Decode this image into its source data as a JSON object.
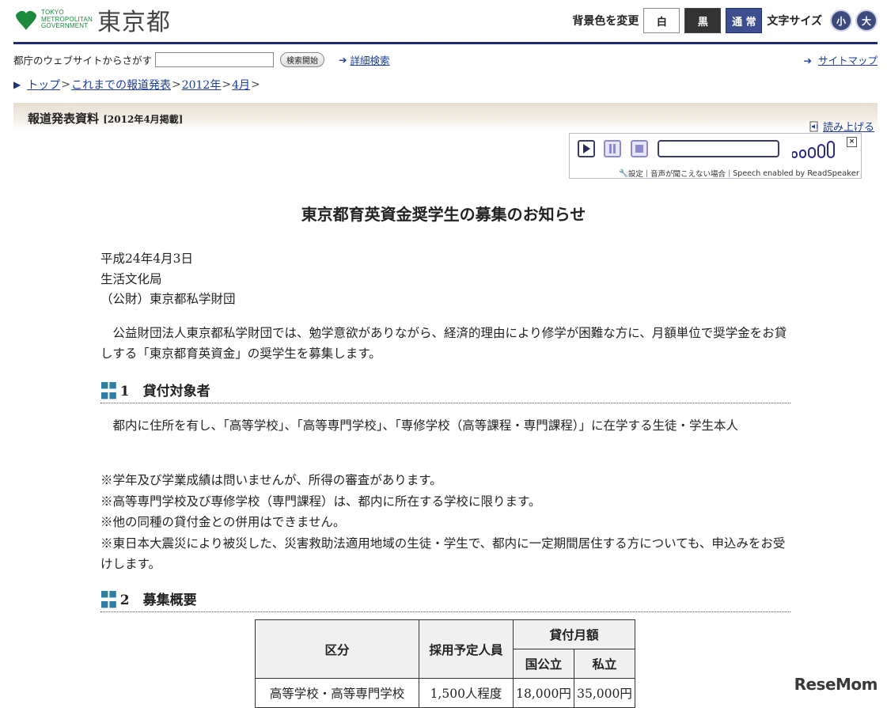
{
  "header": {
    "logo_small": [
      "TOKYO",
      "METROPOLITAN",
      "GOVERNMENT"
    ],
    "logo_big": "東京都",
    "bg_change_label": "背景色を変更",
    "bg_white": "白",
    "bg_black": "黒",
    "bg_normal": "通 常",
    "font_size_label": "文字サイズ",
    "font_small": "小",
    "font_large": "大"
  },
  "search": {
    "label": "都庁のウェブサイトからさがす",
    "value": "",
    "button": "検索開始",
    "advanced_link": "詳細検索",
    "sitemap_link": "サイトマップ"
  },
  "breadcrumb": {
    "items": [
      "トップ",
      "これまでの報道発表",
      "2012年",
      "4月"
    ],
    "separator": ">"
  },
  "banner": {
    "title": "報道発表資料",
    "date": "[2012年4月掲載]",
    "read_aloud": "読み上げる"
  },
  "speaker": {
    "settings": "設定",
    "help": "音声が聞こえない場合",
    "powered": "Speech enabled by",
    "brand": "ReadSpeaker"
  },
  "article": {
    "title": "東京都育英資金奨学生の募集のお知らせ",
    "date": "平成24年4月3日",
    "dept1": "生活文化局",
    "dept2": "（公財）東京都私学財団",
    "intro": "公益財団法人東京都私学財団では、勉学意欲がありながら、経済的理由により修学が困難な方に、月額単位で奨学金をお貸しする「東京都育英資金」の奨学生を募集します。",
    "section1_title": "1　貸付対象者",
    "section1_body": "都内に住所を有し、「高等学校」、「高等専門学校」、「専修学校（高等課程・専門課程）」に在学する生徒・学生本人",
    "notes": [
      "※学年及び学業成績は問いませんが、所得の審査があります。",
      "※高等専門学校及び専修学校（専門課程）は、都内に所在する学校に限ります。",
      "※他の同種の貸付金との併用はできません。",
      "※東日本大震災により被災した、災害救助法適用地域の生徒・学生で、都内に一定期間居住する方についても、申込みをお受けします。"
    ],
    "section2_title": "2　募集概要"
  },
  "table": {
    "col_category": "区分",
    "col_quota": "採用予定人員",
    "col_monthly": "貸付月額",
    "col_public": "国公立",
    "col_private": "私立",
    "rows": [
      {
        "category": "高等学校・高等専門学校",
        "quota": "1,500人程度",
        "public": "18,000円",
        "private": "35,000円"
      }
    ]
  },
  "watermark": "ReseMom"
}
